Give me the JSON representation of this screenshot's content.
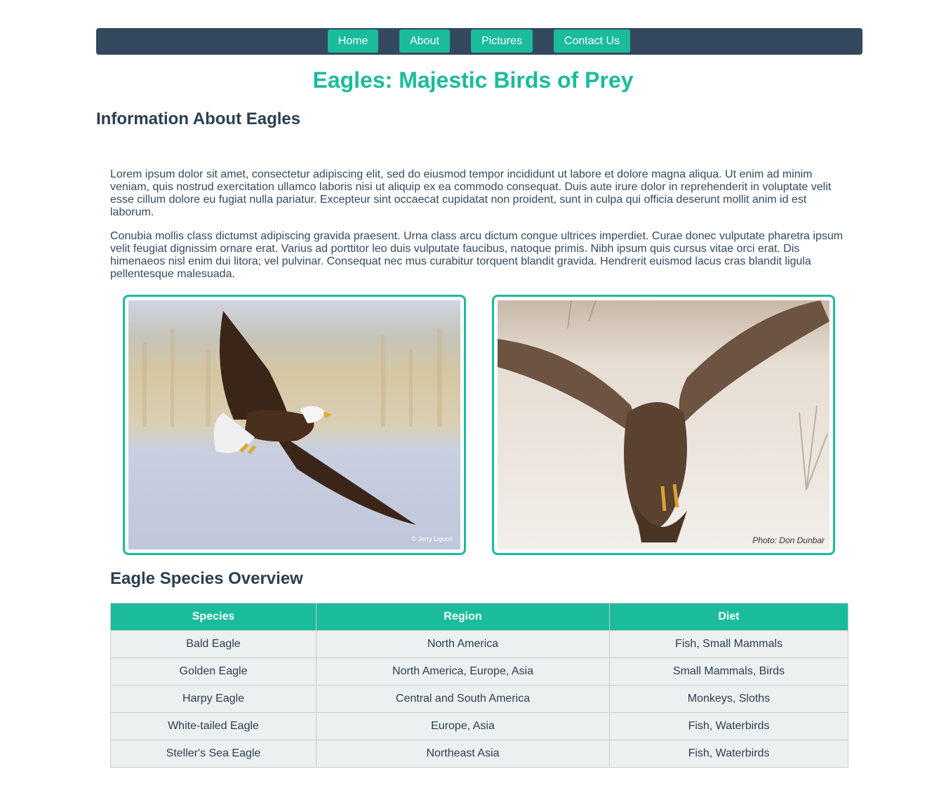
{
  "nav": {
    "items": [
      {
        "label": "Home"
      },
      {
        "label": "About"
      },
      {
        "label": "Pictures"
      },
      {
        "label": "Contact Us"
      }
    ]
  },
  "page": {
    "title": "Eagles: Majestic Birds of Prey",
    "section_heading": "Information About Eagles",
    "paragraphs": [
      "Lorem ipsum dolor sit amet, consectetur adipiscing elit, sed do eiusmod tempor incididunt ut labore et dolore magna aliqua. Ut enim ad minim veniam, quis nostrud exercitation ullamco laboris nisi ut aliquip ex ea commodo consequat. Duis aute irure dolor in reprehenderit in voluptate velit esse cillum dolore eu fugiat nulla pariatur. Excepteur sint occaecat cupidatat non proident, sunt in culpa qui officia deserunt mollit anim id est laborum.",
      "Conubia mollis class dictumst adipiscing gravida praesent. Urna class arcu dictum congue ultrices imperdiet. Curae donec vulputate pharetra ipsum velit feugiat dignissim ornare erat. Varius ad porttitor leo duis vulputate faucibus, natoque primis. Nibh ipsum quis cursus vitae orci erat. Dis himenaeos nisl enim dui litora; vel pulvinar. Consequat nec mus curabitur torquent blandit gravida. Hendrerit euismod lacus cras blandit ligula pellentesque malesuada."
    ]
  },
  "photos": {
    "left_credit": "© Jerry Liguori",
    "right_credit": "Photo: Don Dunbar"
  },
  "table": {
    "heading": "Eagle Species Overview",
    "headers": [
      "Species",
      "Region",
      "Diet"
    ],
    "rows": [
      [
        "Bald Eagle",
        "North America",
        "Fish, Small Mammals"
      ],
      [
        "Golden Eagle",
        "North America, Europe, Asia",
        "Small Mammals, Birds"
      ],
      [
        "Harpy Eagle",
        "Central and South America",
        "Monkeys, Sloths"
      ],
      [
        "White-tailed Eagle",
        "Europe, Asia",
        "Fish, Waterbirds"
      ],
      [
        "Steller's Sea Eagle",
        "Northeast Asia",
        "Fish, Waterbirds"
      ]
    ]
  },
  "colors": {
    "accent": "#1abc9c",
    "nav_background": "#34495e",
    "text": "#2c3e50",
    "table_cell": "#ecf0f1"
  }
}
